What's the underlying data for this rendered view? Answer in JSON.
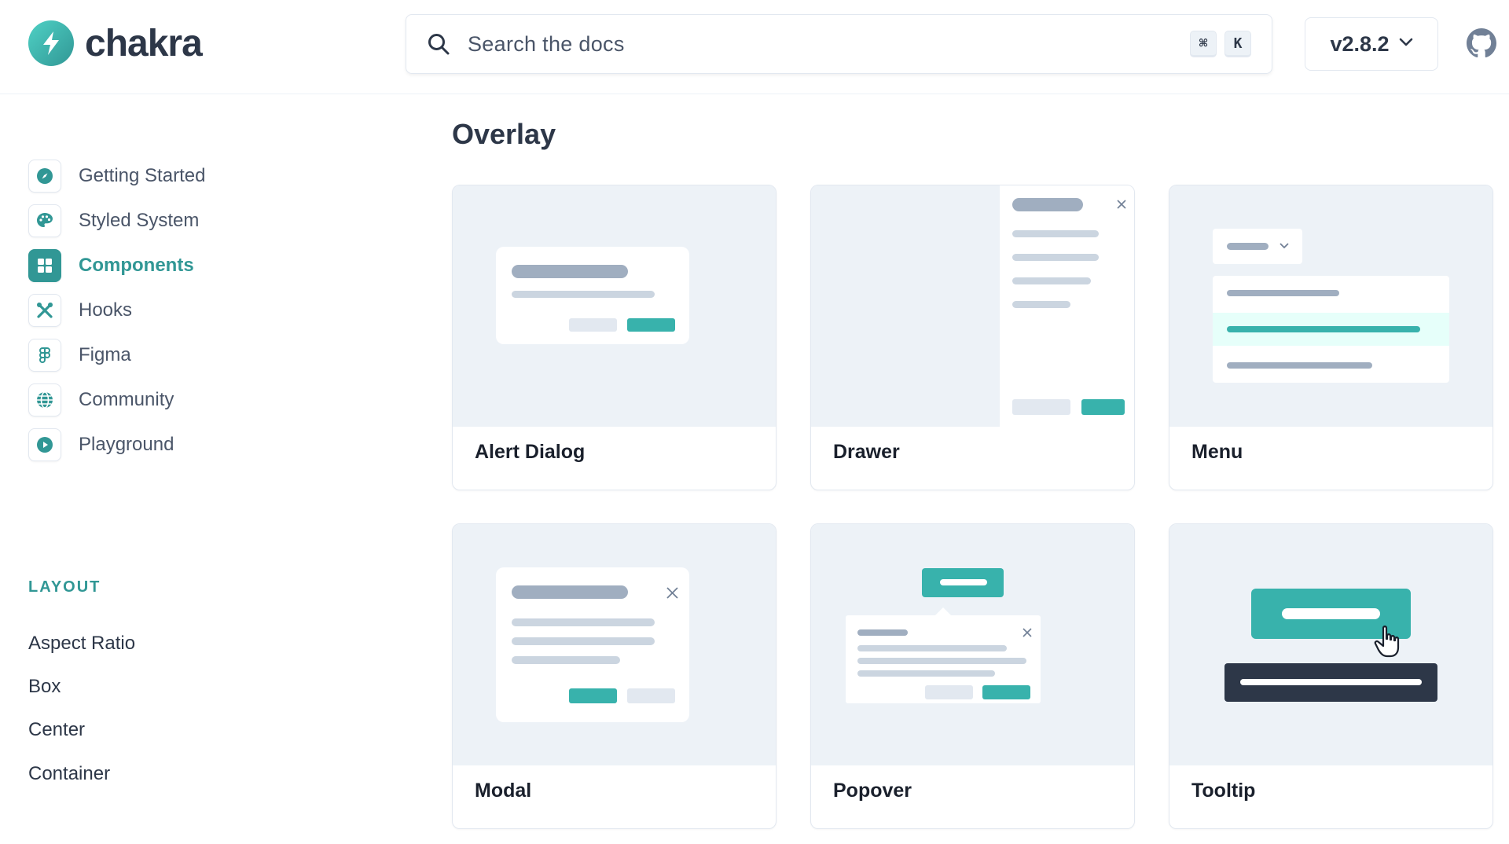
{
  "header": {
    "logo_text": "chakra",
    "search": {
      "placeholder": "Search the docs",
      "shortcut_keys": [
        "⌘",
        "K"
      ]
    },
    "version": "v2.8.2"
  },
  "sidebar": {
    "items": [
      {
        "label": "Getting Started",
        "icon": "compass-icon",
        "active": false
      },
      {
        "label": "Styled System",
        "icon": "palette-icon",
        "active": false
      },
      {
        "label": "Components",
        "icon": "grid-icon",
        "active": true
      },
      {
        "label": "Hooks",
        "icon": "tools-icon",
        "active": false
      },
      {
        "label": "Figma",
        "icon": "figma-icon",
        "active": false
      },
      {
        "label": "Community",
        "icon": "globe-icon",
        "active": false
      },
      {
        "label": "Playground",
        "icon": "play-icon",
        "active": false
      }
    ],
    "section_title": "LAYOUT",
    "sub_items": [
      "Aspect Ratio",
      "Box",
      "Center",
      "Container"
    ]
  },
  "main": {
    "title": "Overlay",
    "cards": [
      {
        "label": "Alert Dialog"
      },
      {
        "label": "Drawer"
      },
      {
        "label": "Menu"
      },
      {
        "label": "Modal"
      },
      {
        "label": "Popover"
      },
      {
        "label": "Tooltip"
      }
    ]
  },
  "colors": {
    "accent": "#319795",
    "accent_light": "#38b2ac",
    "text": "#2d3748",
    "preview_bg": "#edf2f7"
  }
}
